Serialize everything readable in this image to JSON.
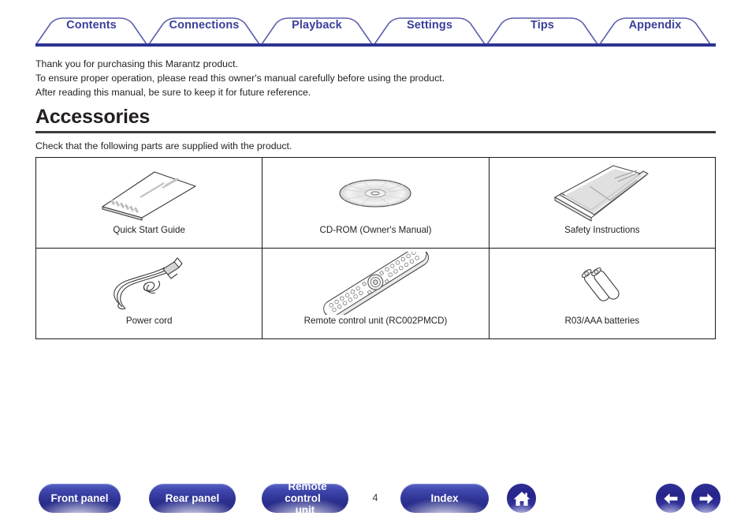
{
  "nav_tabs": [
    {
      "label": "Contents"
    },
    {
      "label": "Connections"
    },
    {
      "label": "Playback"
    },
    {
      "label": "Settings"
    },
    {
      "label": "Tips"
    },
    {
      "label": "Appendix"
    }
  ],
  "intro": {
    "line1": "Thank you for purchasing this Marantz product.",
    "line2": "To ensure proper operation, please read this owner's manual carefully before using the product.",
    "line3": "After reading this manual, be sure to keep it for future reference."
  },
  "heading": {
    "title": "Accessories",
    "subtitle": "Check that the following parts are supplied with the product."
  },
  "accessories": {
    "rows": [
      [
        {
          "caption": "Quick Start Guide",
          "icon": "booklet-icon"
        },
        {
          "caption": "CD-ROM (Owner's Manual)",
          "icon": "cd-disc-icon"
        },
        {
          "caption": "Safety Instructions",
          "icon": "leaflet-icon"
        }
      ],
      [
        {
          "caption": "Power cord",
          "icon": "power-cord-icon"
        },
        {
          "caption": "Remote control unit (RC002PMCD)",
          "icon": "remote-control-icon"
        },
        {
          "caption": "R03/AAA batteries",
          "icon": "batteries-icon"
        }
      ]
    ]
  },
  "footer": {
    "front_panel": "Front panel",
    "rear_panel": "Rear panel",
    "remote_control_unit": "Remote control\nunit",
    "remote_control_line1": "Remote control",
    "remote_control_line2": "unit",
    "index": "Index",
    "page_number": "4",
    "home_icon": "home-icon",
    "prev_icon": "arrow-left-icon",
    "next_icon": "arrow-right-icon"
  },
  "colors": {
    "tab_text": "#3a3f9b",
    "tab_outline": "#5a5fae",
    "tab_rule": "#2d3392",
    "button_blue_light": "#5a63c4",
    "button_blue_dark": "#272a86",
    "heading_rule": "#3c3c3c",
    "body_text": "#231f20"
  }
}
